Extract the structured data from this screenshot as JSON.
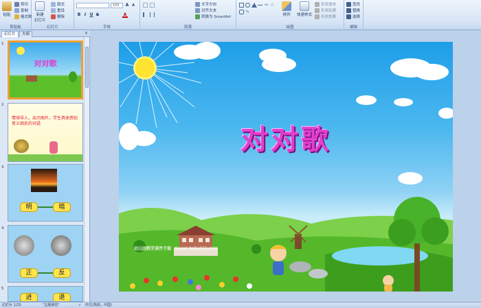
{
  "ribbon": {
    "clipboard": {
      "label": "剪贴板",
      "paste": "粘贴",
      "cut": "剪切",
      "copy": "复制",
      "format_painter": "格式刷"
    },
    "slides": {
      "label": "幻灯片",
      "new_slide_line1": "新建",
      "new_slide_line2": "幻灯片",
      "layout": "版式",
      "reset": "重设",
      "delete": "删除"
    },
    "font": {
      "label": "字体",
      "font_name": "",
      "font_size": "105"
    },
    "paragraph": {
      "label": "段落",
      "text_direction": "文字方向",
      "align_text": "对齐文本",
      "smartart": "转换为 SmartArt"
    },
    "drawing": {
      "label": "绘图",
      "arrange": "排列",
      "quick_styles": "快速样式",
      "shape_fill": "形状填充",
      "shape_outline": "形状轮廓",
      "shape_effects": "形状效果"
    },
    "editing": {
      "label": "编辑",
      "find": "查找",
      "replace": "替换",
      "select": "选择"
    }
  },
  "panel": {
    "tabs": [
      "幻灯片",
      "大纲"
    ],
    "slides": [
      {
        "num": "1",
        "title": "对对歌"
      },
      {
        "num": "2",
        "text": "情境导入，出示图片，学生具体感知意义相反的词语"
      },
      {
        "num": "3",
        "word_left": "明",
        "word_right": "暗"
      },
      {
        "num": "4",
        "word_left": "正",
        "word_right": "反"
      },
      {
        "num": "5",
        "word_left": "进",
        "word_right": "退"
      }
    ]
  },
  "slide": {
    "title": "对对歌",
    "footer_label": "幼儿园教学课件下载",
    "footer_url": "ziyuan.baby611.com"
  },
  "status": {
    "slide_info": "幻灯片 1/25",
    "theme": "\"古瓶荷花\"",
    "language": "中文(简体，中国)"
  },
  "colors": {
    "ribbon_bg": "#d8e6f6",
    "panel_bg": "#dce7f5",
    "selected_thumb_border": "#f0a030",
    "title_color": "#e33fd0",
    "sky": "#4cb8ef",
    "grass": "#5cbf2a"
  }
}
